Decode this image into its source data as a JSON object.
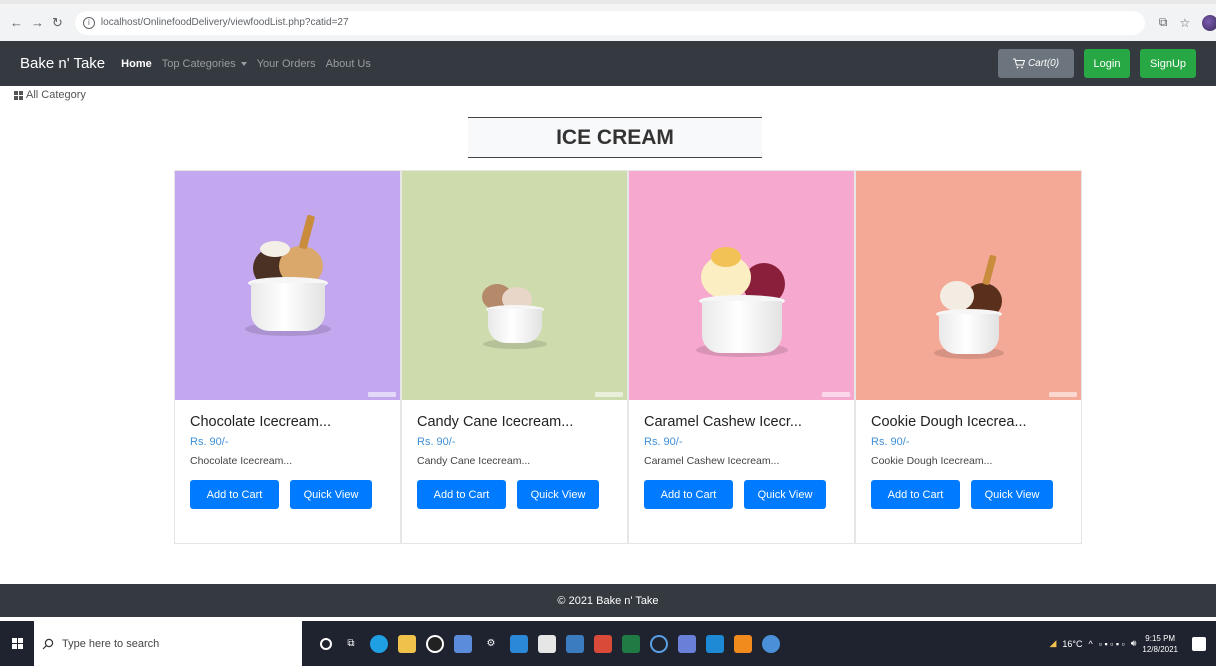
{
  "browser": {
    "url": "localhost/OnlinefoodDelivery/viewfoodList.php?catid=27"
  },
  "navbar": {
    "brand": "Bake n' Take",
    "links": [
      {
        "label": "Home",
        "active": true
      },
      {
        "label": "Top Categories",
        "active": false,
        "dropdown": true
      },
      {
        "label": "Your Orders",
        "active": false
      },
      {
        "label": "About Us",
        "active": false
      }
    ],
    "cart_label": "Cart(0)",
    "login_label": "Login",
    "signup_label": "SignUp"
  },
  "category_link": "All Category",
  "heading": "ICE CREAM",
  "products": [
    {
      "title": "Chocolate Icecream...",
      "price": "Rs. 90/-",
      "desc": "Chocolate Icecream...",
      "add_label": "Add to Cart",
      "view_label": "Quick View",
      "bg": "#c3a8ef",
      "scoop1": "#4b3124",
      "scoop2": "#d9a86a"
    },
    {
      "title": "Candy Cane Icecream...",
      "price": "Rs. 90/-",
      "desc": "Candy Cane Icecream...",
      "add_label": "Add to Cart",
      "view_label": "Quick View",
      "bg": "#cedcad",
      "scoop1": "#b58a6a",
      "scoop2": "#e8d6c8"
    },
    {
      "title": "Caramel Cashew Icecr...",
      "price": "Rs. 90/-",
      "desc": "Caramel Cashew Icecream...",
      "add_label": "Add to Cart",
      "view_label": "Quick View",
      "bg": "#f6a8cf",
      "scoop1": "#8a1f3c",
      "scoop2": "#fbeec2"
    },
    {
      "title": "Cookie Dough Icecrea...",
      "price": "Rs. 90/-",
      "desc": "Cookie Dough Icecream...",
      "add_label": "Add to Cart",
      "view_label": "Quick View",
      "bg": "#f4a896",
      "scoop1": "#5a2f1c",
      "scoop2": "#f3ece3"
    }
  ],
  "footer": "© 2021 Bake n' Take",
  "taskbar": {
    "search_placeholder": "Type here to search",
    "weather": "16°C",
    "time": "9:15 PM",
    "date": "12/8/2021"
  },
  "colors": {
    "navbar_bg": "#343a40",
    "primary": "#007bff",
    "success": "#28a745",
    "secondary": "#6c757d",
    "price": "#3f8fd8"
  }
}
